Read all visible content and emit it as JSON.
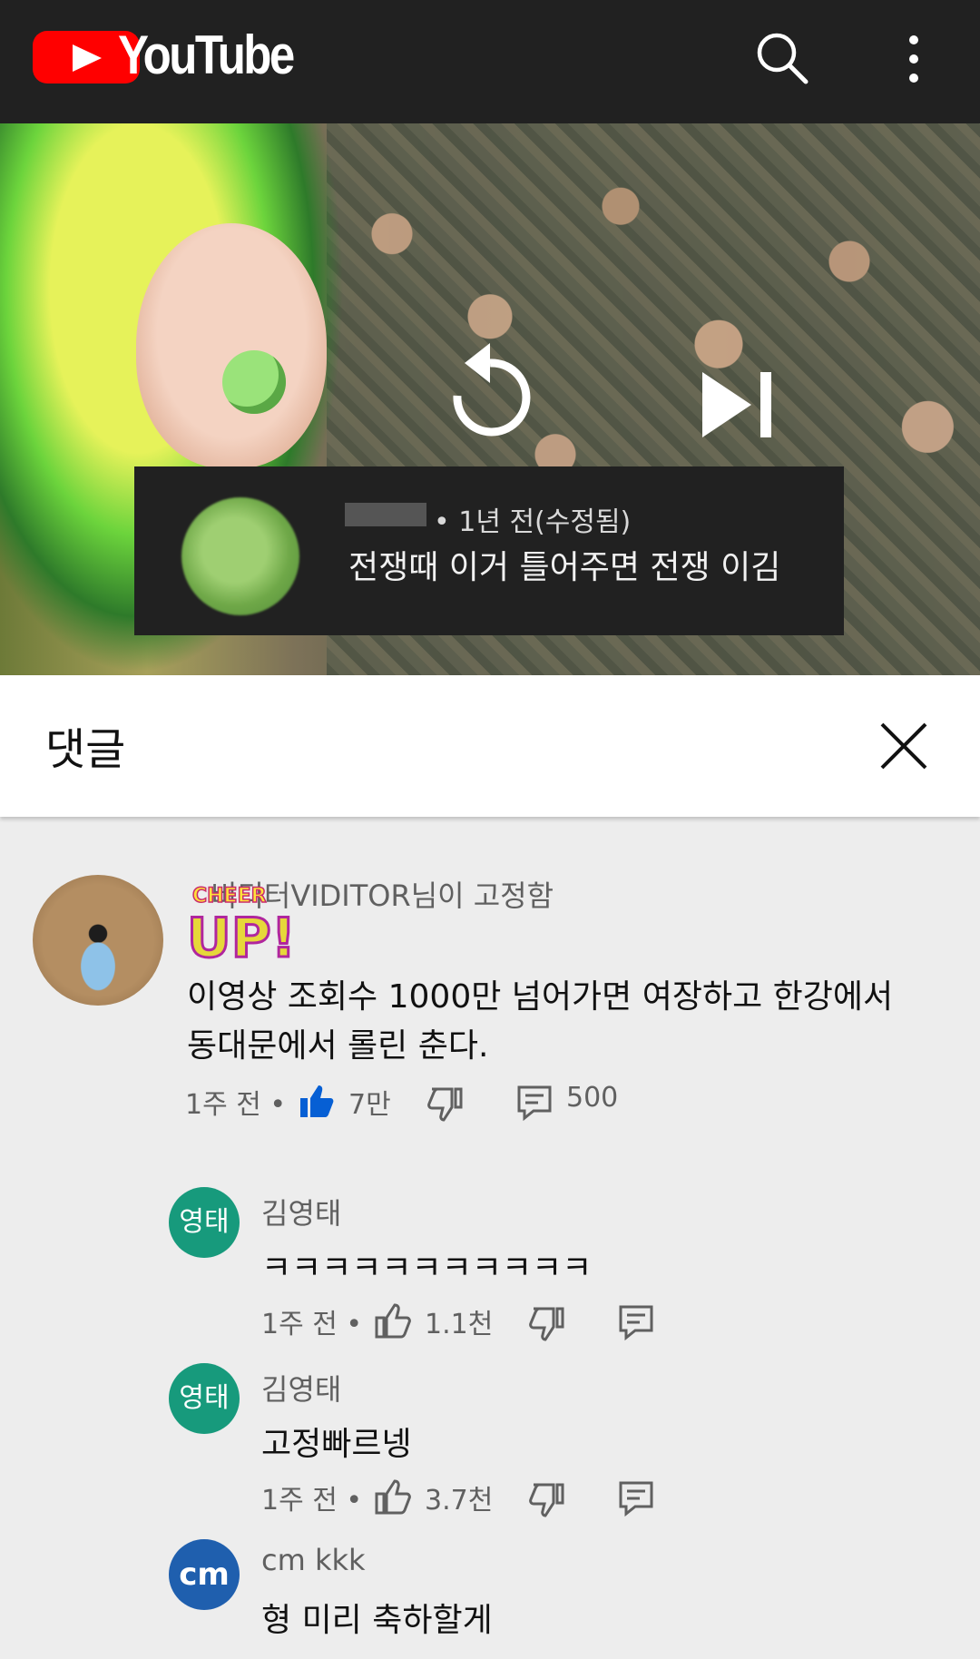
{
  "app": {
    "name": "YouTube"
  },
  "video_overlay_comment": {
    "time": "• 1년 전(수정됨)",
    "text": "전쟁때 이거 틀어주면 전쟁 이김"
  },
  "comments_panel": {
    "title": "댓글"
  },
  "pinned_comment": {
    "pinned_label": "비디터VIDITOR님이 고정함",
    "sticker_text": "CHEER UP!",
    "text": "이영상 조회수 1000만 넘어가면 여장하고 한강에서 동대문에서 롤린 춘다.",
    "time": "1주 전 •",
    "likes": "7만",
    "replies": "500"
  },
  "replies": [
    {
      "avatar": "영태",
      "avatar_color": "#179a7c",
      "name": "김영태",
      "text": "ㅋㅋㅋㅋㅋㅋㅋㅋㅋㅋㅋ",
      "time": "1주 전 •",
      "likes": "1.1천"
    },
    {
      "avatar": "영태",
      "avatar_color": "#179a7c",
      "name": "김영태",
      "text": "고정빠르넹",
      "time": "1주 전 •",
      "likes": "3.7천"
    },
    {
      "avatar": "cm",
      "avatar_color": "#1f5fae",
      "name": "cm kkk",
      "text": "형 미리 축하할게"
    }
  ],
  "colors": {
    "topbar": "#212121",
    "brand_red": "#ff0000",
    "like_active": "#065fd4"
  },
  "icons": [
    "search-icon",
    "more-icon",
    "replay-icon",
    "skip-next-icon",
    "close-icon",
    "thumb-up-icon",
    "thumb-down-icon",
    "reply-icon"
  ]
}
